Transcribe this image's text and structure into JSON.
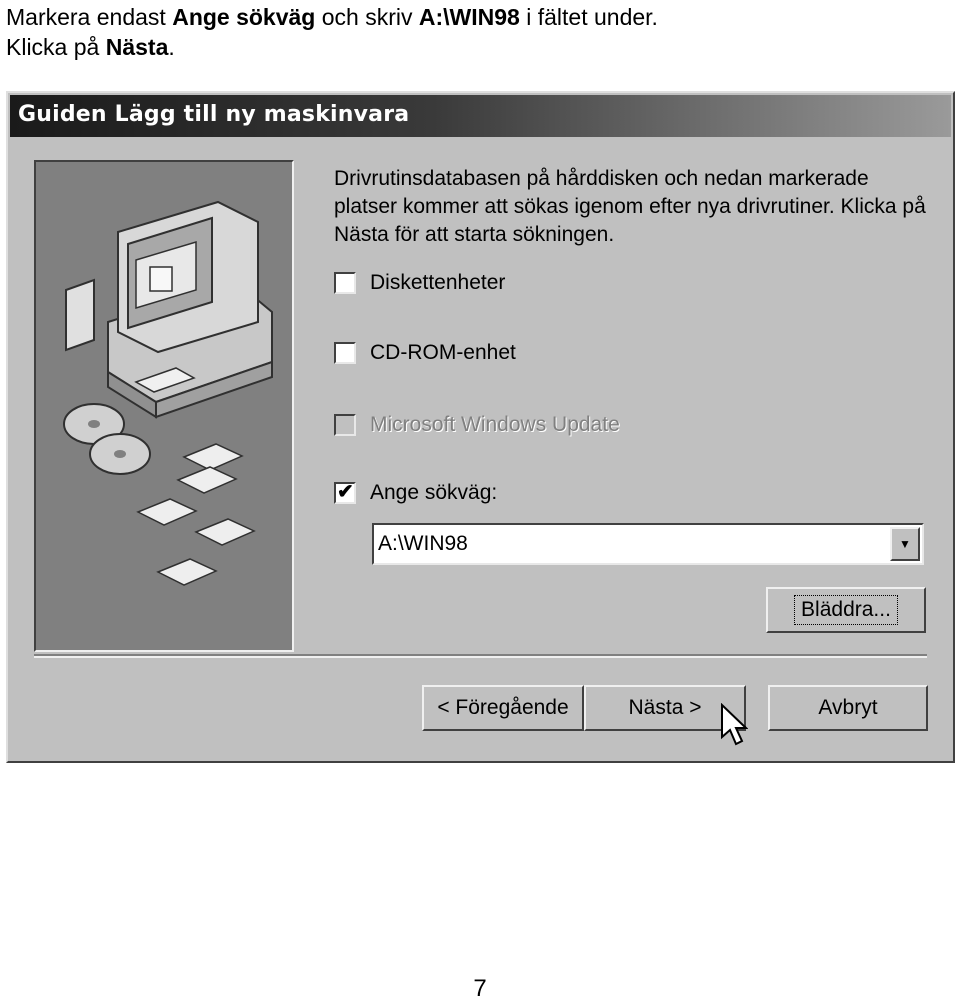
{
  "instruction": {
    "line1_a": "Markera endast ",
    "line1_b": "Ange sökväg",
    "line1_c": " och skriv ",
    "line1_d": "A:\\WIN98",
    "line1_e": " i fältet under.",
    "line2_a": "Klicka på ",
    "line2_b": "Nästa",
    "line2_c": "."
  },
  "dialog": {
    "title": "Guiden Lägg till ny maskinvara",
    "description": "Drivrutinsdatabasen på hårddisken och nedan markerade platser kommer att sökas igenom efter nya drivrutiner. Klicka på Nästa för att starta sökningen.",
    "options": [
      {
        "label": "Diskettenheter",
        "checked": false,
        "enabled": true
      },
      {
        "label": "CD-ROM-enhet",
        "checked": false,
        "enabled": true
      },
      {
        "label": "Microsoft Windows Update",
        "checked": false,
        "enabled": false
      },
      {
        "label": "Ange sökväg:",
        "checked": true,
        "enabled": true
      }
    ],
    "path_value": "A:\\WIN98",
    "browse_button": "Bläddra...",
    "back_button": "< Föregående",
    "next_button": "Nästa >",
    "cancel_button": "Avbryt",
    "check_glyph": "✔",
    "dropdown_glyph": "▼"
  },
  "page_number": "7"
}
